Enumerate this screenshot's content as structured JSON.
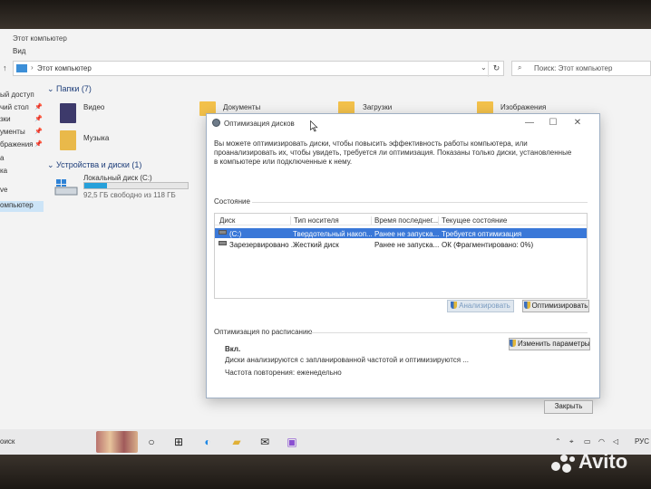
{
  "explorer": {
    "window_title": "Этот компьютер",
    "ribbon": [
      "Вид"
    ],
    "address": "Этот компьютер",
    "search_placeholder": "Поиск: Этот компьютер",
    "nav_items": [
      {
        "label": "ый доступ",
        "pinned": false
      },
      {
        "label": "чий стол",
        "pinned": true
      },
      {
        "label": "зки",
        "pinned": true
      },
      {
        "label": "ументы",
        "pinned": true
      },
      {
        "label": "бражения",
        "pinned": true
      },
      {
        "label": "а",
        "pinned": false
      },
      {
        "label": "ка",
        "pinned": false
      },
      {
        "label": "ve",
        "pinned": false
      },
      {
        "label": "омпьютер",
        "pinned": false,
        "selected": true
      }
    ],
    "folders_header": "Папки (7)",
    "folders": [
      "Видео",
      "Документы",
      "Загрузки",
      "Изображения",
      "Музыка"
    ],
    "devices_header": "Устройства и диски (1)",
    "drive": {
      "name": "Локальный диск (C:)",
      "space": "92,5 ГБ свободно из 118 ГБ",
      "used_fraction": 0.22
    }
  },
  "dialog": {
    "title": "Оптимизация дисков",
    "description": "Вы можете оптимизировать диски, чтобы повысить эффективность работы компьютера, или проанализировать их, чтобы увидеть, требуется ли оптимизация. Показаны только диски, установленные в компьютере или подключенные к нему.",
    "status_label": "Состояние",
    "columns": [
      "Диск",
      "Тип носителя",
      "Время последнег...",
      "Текущее состояние"
    ],
    "rows": [
      {
        "disk": "(C:)",
        "media": "Твердотельный накоп...",
        "last": "Ранее не запуска...",
        "state": "Требуется оптимизация",
        "selected": true
      },
      {
        "disk": "Зарезервировано ...",
        "media": "Жесткий диск",
        "last": "Ранее не запуска...",
        "state": "ОК (Фрагментировано: 0%)",
        "selected": false
      }
    ],
    "analyze_button": "Анализировать",
    "optimize_button": "Оптимизировать",
    "schedule_label": "Оптимизация по расписанию",
    "schedule_state": "Вкл.",
    "schedule_desc": "Диски анализируются с запланированной частотой и оптимизируются ...",
    "schedule_freq": "Частота повторения: еженедельно",
    "change_button": "Изменить параметры",
    "close_button": "Закрыть"
  },
  "taskbar": {
    "search_text": "оиск",
    "tray_text": "РУС"
  },
  "watermark": "Avito"
}
